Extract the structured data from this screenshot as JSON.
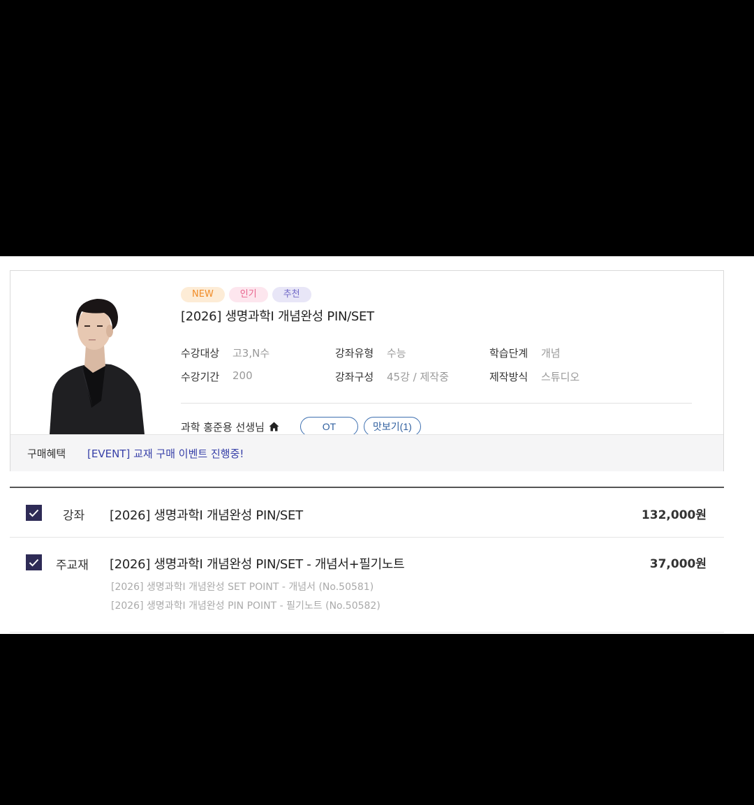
{
  "badges": {
    "new": "NEW",
    "popular": "인기",
    "recommended": "추천"
  },
  "course": {
    "title": "[2026] 생명과학I 개념완성 PIN/SET"
  },
  "info": [
    [
      {
        "label": "수강대상",
        "value": "고3,N수"
      },
      {
        "label": "강좌유형",
        "value": "수능"
      },
      {
        "label": "학습단계",
        "value": "개념"
      }
    ],
    [
      {
        "label": "수강기간",
        "value": "200"
      },
      {
        "label": "강좌구성",
        "value": "45강 / 제작중"
      },
      {
        "label": "제작방식",
        "value": "스튜디오"
      }
    ]
  ],
  "teacher": {
    "name": "과학 홍준용 선생님",
    "icon": "home-icon"
  },
  "buttons": {
    "ot": "OT",
    "preview": "맛보기(1)"
  },
  "benefit": {
    "label": "구매혜택",
    "text": "[EVENT] 교재 구매 이벤트 진행중!"
  },
  "cart": {
    "lecture": {
      "type": "강좌",
      "title": "[2026] 생명과학I 개념완성 PIN/SET",
      "price": "132,000원",
      "checked": true
    },
    "book": {
      "type": "주교재",
      "title": "[2026] 생명과학I 개념완성 PIN/SET - 개념서+필기노트",
      "price": "37,000원",
      "checked": true,
      "items": [
        "[2026] 생명과학I 개념완성 SET POINT - 개념서 (No.50581)",
        "[2026] 생명과학I 개념완성 PIN POINT - 필기노트 (No.50582)"
      ]
    }
  },
  "colors": {
    "accent": "#2e2b56",
    "link": "#3740a8",
    "pill_border": "#3d6fb0"
  }
}
